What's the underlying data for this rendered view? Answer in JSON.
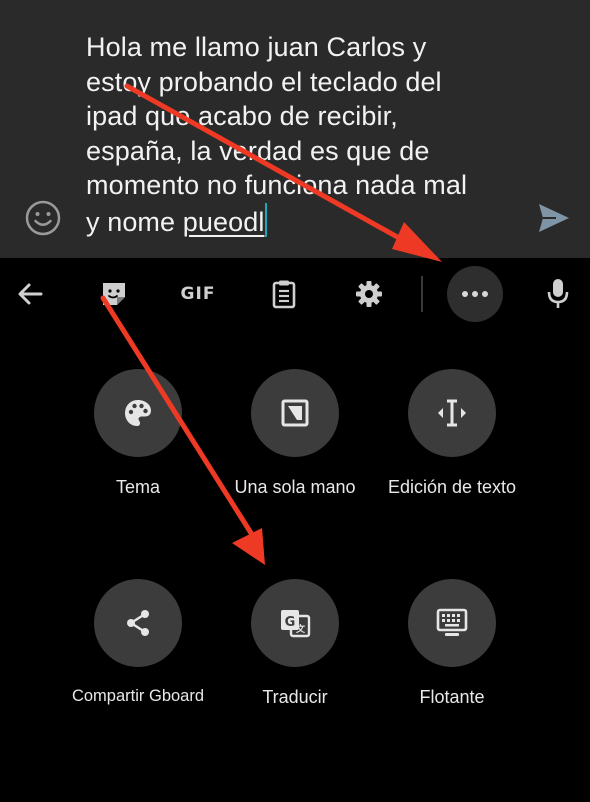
{
  "composer": {
    "line1": "Hola me llamo juan Carlos y",
    "line2": "estoy probando el teclado del",
    "line3": "ipad que acabo de recibir,",
    "line4": "españa, la verdad es que de",
    "line5": "momento no funciona nada mal",
    "line6_prefix": "y nome ",
    "line6_misspelled": "pueodl",
    "emoji_icon": "emoji-smiley-icon",
    "send_icon": "send-icon"
  },
  "toolbar": {
    "back_icon": "arrow-back-icon",
    "sticker_icon": "sticker-icon",
    "gif_label": "GIF",
    "clipboard_icon": "clipboard-icon",
    "settings_icon": "gear-icon",
    "more_icon": "more-dots-icon",
    "mic_icon": "microphone-icon"
  },
  "menu": {
    "items": [
      {
        "label": "Tema",
        "icon": "palette-icon"
      },
      {
        "label": "Una sola mano",
        "icon": "one-handed-icon"
      },
      {
        "label": "Edición de texto",
        "icon": "text-cursor-icon"
      },
      {
        "label": "Compartir Gboard",
        "icon": "share-icon"
      },
      {
        "label": "Traducir",
        "icon": "translate-icon"
      },
      {
        "label": "Flotante",
        "icon": "floating-keyboard-icon"
      }
    ]
  },
  "colors": {
    "composer_bg": "#2a2a2a",
    "keyboard_bg": "#000000",
    "circle_bg": "#3c3c3c",
    "caret": "#1fa8b8",
    "annotation_arrow": "#ee3a24"
  }
}
